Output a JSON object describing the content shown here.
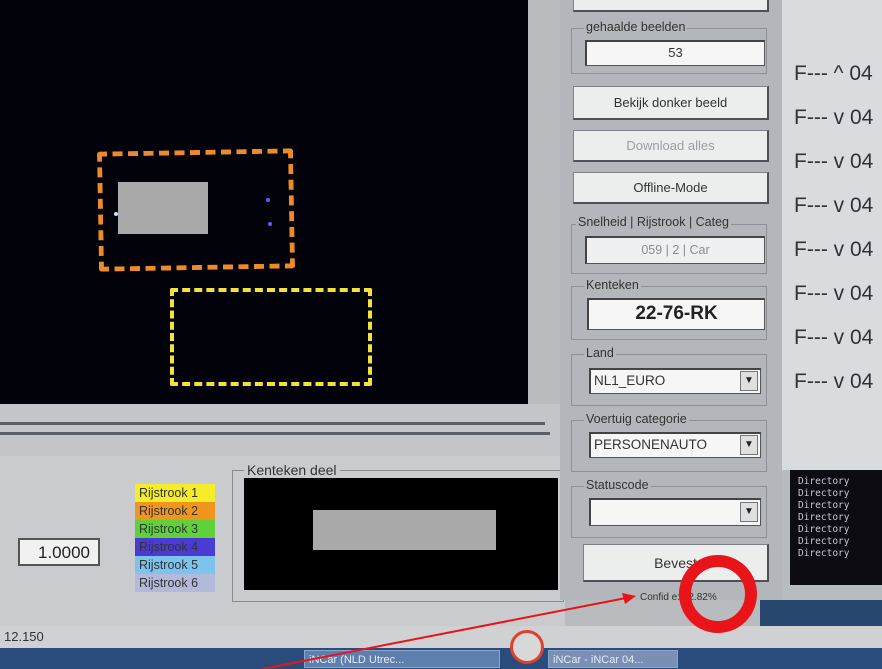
{
  "camera": {
    "zones": [
      {
        "name": "lane-2-zone",
        "color": "#ee8a2a"
      },
      {
        "name": "lane-1-zone",
        "color": "#f3e23c"
      }
    ]
  },
  "panel": {
    "images_fetched_label": "gehaalde beelden",
    "images_fetched_value": "53",
    "view_dark_image_button": "Bekijk donker beeld",
    "download_all_button": "Download alles",
    "offline_mode_button": "Offline-Mode",
    "speed_group_label": "Snelheid | Rijstrook | Categ",
    "speed_lane_category_value": "059  |  2  |  Car",
    "plate_group_label": "Kenteken",
    "plate_value": "22-76-RK",
    "country_label": "Land",
    "country_value": "NL1_EURO",
    "vehicle_category_label": "Voertuig categorie",
    "vehicle_category_value": "PERSONENAUTO",
    "status_code_label": "Statuscode",
    "status_code_value": "",
    "confirm_button": "Bevest",
    "confidence_text": "Confid   e: 12.82%"
  },
  "bottom": {
    "zoom_value": "1.0000",
    "plate_crop_label": "Kenteken deel",
    "lanes": [
      {
        "label": "Rijstrook 1",
        "color": "#f5ec2a"
      },
      {
        "label": "Rijstrook 2",
        "color": "#f0961e"
      },
      {
        "label": "Rijstrook 3",
        "color": "#5fd13a"
      },
      {
        "label": "Rijstrook 4",
        "color": "#4a3ad6"
      },
      {
        "label": "Rijstrook 5",
        "color": "#7cc3ee"
      },
      {
        "label": "Rijstrook 6",
        "color": "#b3b9d8"
      }
    ]
  },
  "log": {
    "lines": [
      "F--- ^ 04",
      "F--- v 04",
      "F--- v 04",
      "F--- v 04",
      "F--- v 04",
      "F--- v 04",
      "F--- v 04",
      "F--- v 04"
    ],
    "console": [
      "Directory",
      "Directory",
      "Directory",
      "Directory",
      "Directory",
      "Directory",
      "Directory"
    ]
  },
  "statusbar": {
    "text": "12.150"
  },
  "taskbar": {
    "items": [
      {
        "label": "iNCar (NLD Utrec..."
      },
      {
        "label": "iNCar - iNCar 04..."
      }
    ]
  },
  "annotation": {
    "circle_color": "#e8141a",
    "arrow_color": "#e8141a"
  }
}
